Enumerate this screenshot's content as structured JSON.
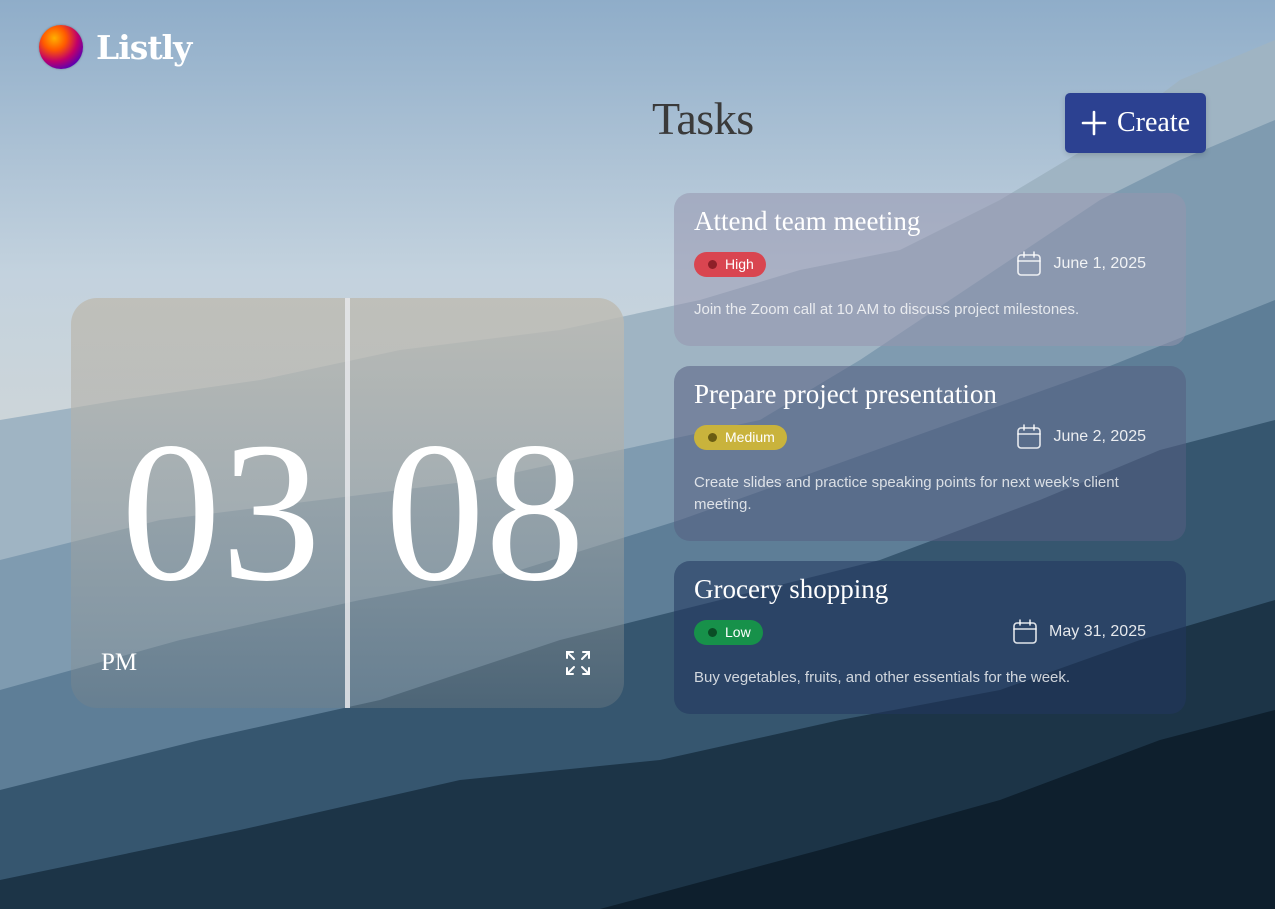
{
  "app": {
    "name": "Listly"
  },
  "header": {
    "title": "Tasks",
    "create_label": "Create"
  },
  "clock": {
    "hours": "03",
    "minutes": "08",
    "period": "PM"
  },
  "tasks": [
    {
      "title": "Attend team meeting",
      "priority": "High",
      "date": "June 1, 2025",
      "description": "Join the Zoom call at 10 AM to discuss project milestones."
    },
    {
      "title": "Prepare project presentation",
      "priority": "Medium",
      "date": "June 2, 2025",
      "description": "Create slides and practice speaking points for next week's client meeting."
    },
    {
      "title": "Grocery shopping",
      "priority": "Low",
      "date": "May 31, 2025",
      "description": "Buy vegetables, fruits, and other essentials for the week."
    }
  ],
  "colors": {
    "create_button": "#2c4191",
    "priority_high": "#d94550",
    "priority_medium": "#c9b33c",
    "priority_low": "#17914a"
  },
  "icons": {
    "logo": "gradient-orb-icon",
    "create": "plus-icon",
    "fullscreen": "expand-icon",
    "date": "calendar-icon"
  }
}
